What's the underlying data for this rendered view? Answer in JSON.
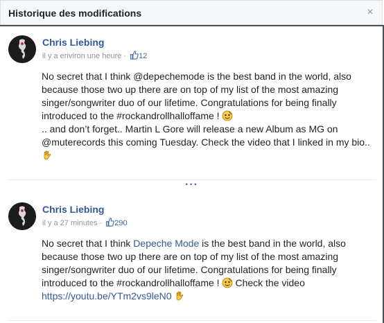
{
  "dialog": {
    "title": "Historique des modifications",
    "close_label": "×"
  },
  "posts": [
    {
      "author": "Chris Liebing",
      "time": "il y a environ une heure",
      "dot": "·",
      "likes": "12",
      "lines": [
        "No secret that I think @depechemode is the best band in the world, also",
        "because those two up there are on top of my list of the most amazing",
        "singer/songwriter duo of our lifetime. Congratulations for being finally",
        "introduced to the #rockandrollhalloffame !",
        ".. and don’t forget.. Martin L Gore will release a new Album as MG on",
        "@muterecords this coming Tuesday. Check the video that I linked in my bio.."
      ]
    },
    {
      "author": "Chris Liebing",
      "time": "il y a 27 minutes",
      "dot": "·",
      "likes": "290",
      "line1_pre": "No secret that I think ",
      "line1_link": "Depeche Mode",
      "line1_post": " is the best band in the world, also",
      "line2": "because those two up there are on top of my list of the most amazing",
      "line3": "singer/songwriter duo of our lifetime. Congratulations for being finally",
      "line4_pre": "introduced to the #rockandrollhalloffame !",
      "line4_post": " Check the video",
      "url": "https://youtu.be/YTm2vs9leN0"
    }
  ],
  "more": "···",
  "colors": {
    "link": "#365899",
    "like": "#4267b2",
    "muted": "#90949c"
  }
}
